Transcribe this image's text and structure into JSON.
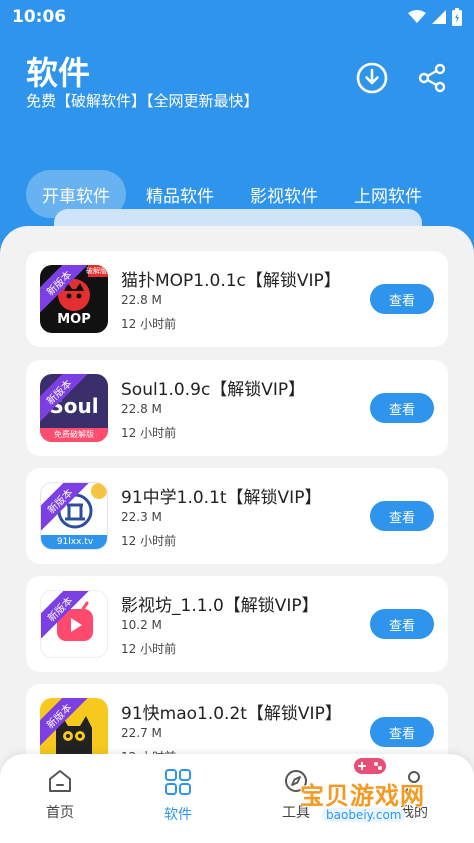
{
  "status_bar": {
    "time": "10:06"
  },
  "header": {
    "title": "软件",
    "subtitle": "免费【破解软件】【全网更新最快】"
  },
  "tabs": [
    {
      "label": "开車软件",
      "active": true
    },
    {
      "label": "精品软件",
      "active": false
    },
    {
      "label": "影视软件",
      "active": false
    },
    {
      "label": "上网软件",
      "active": false
    }
  ],
  "apps": [
    {
      "name": "猫扑MOP1.0.1c【解锁VIP】",
      "size": "22.8 M",
      "time": "12 小时前",
      "button": "查看",
      "ribbon": "新版本",
      "icon_text": "MOP",
      "corner_tag": "破解版",
      "icon_bg": "#111111",
      "accent": "#e32f2f"
    },
    {
      "name": "Soul1.0.9c【解锁VIP】",
      "size": "22.8 M",
      "time": "12 小时前",
      "button": "查看",
      "ribbon": "新版本",
      "icon_text": "Soul",
      "corner_tag": "免费破解版",
      "icon_bg": "#3b2f6b",
      "accent": "#ff4d6d"
    },
    {
      "name": "91中学1.0.1t【解锁VIP】",
      "size": "22.3 M",
      "time": "12 小时前",
      "button": "查看",
      "ribbon": "新版本",
      "icon_text": "91lxx.tv",
      "corner_tag": "",
      "icon_bg": "#ffffff",
      "accent": "#2d4e9e"
    },
    {
      "name": "影视坊_1.1.0【解锁VIP】",
      "size": "10.2 M",
      "time": "12 小时前",
      "button": "查看",
      "ribbon": "新版本",
      "icon_text": "",
      "corner_tag": "",
      "icon_bg": "#ffffff",
      "accent": "#ff4a6e"
    },
    {
      "name": "91快mao1.0.2t【解锁VIP】",
      "size": "22.7 M",
      "time": "12 小时前",
      "button": "查看",
      "ribbon": "新版本",
      "icon_text": "",
      "corner_tag": "",
      "icon_bg": "#f7c81e",
      "accent": "#222222"
    }
  ],
  "bottom_nav": [
    {
      "label": "首页",
      "icon": "home-icon",
      "active": false
    },
    {
      "label": "软件",
      "icon": "grid-icon",
      "active": true
    },
    {
      "label": "工具",
      "icon": "compass-icon",
      "active": false
    },
    {
      "label": "我的",
      "icon": "user-icon",
      "active": false
    }
  ],
  "watermark": {
    "text": "宝贝游戏网",
    "url": "baobeiy.com"
  },
  "colors": {
    "primary": "#2f95ec",
    "ribbon": "#7b3fe4"
  }
}
